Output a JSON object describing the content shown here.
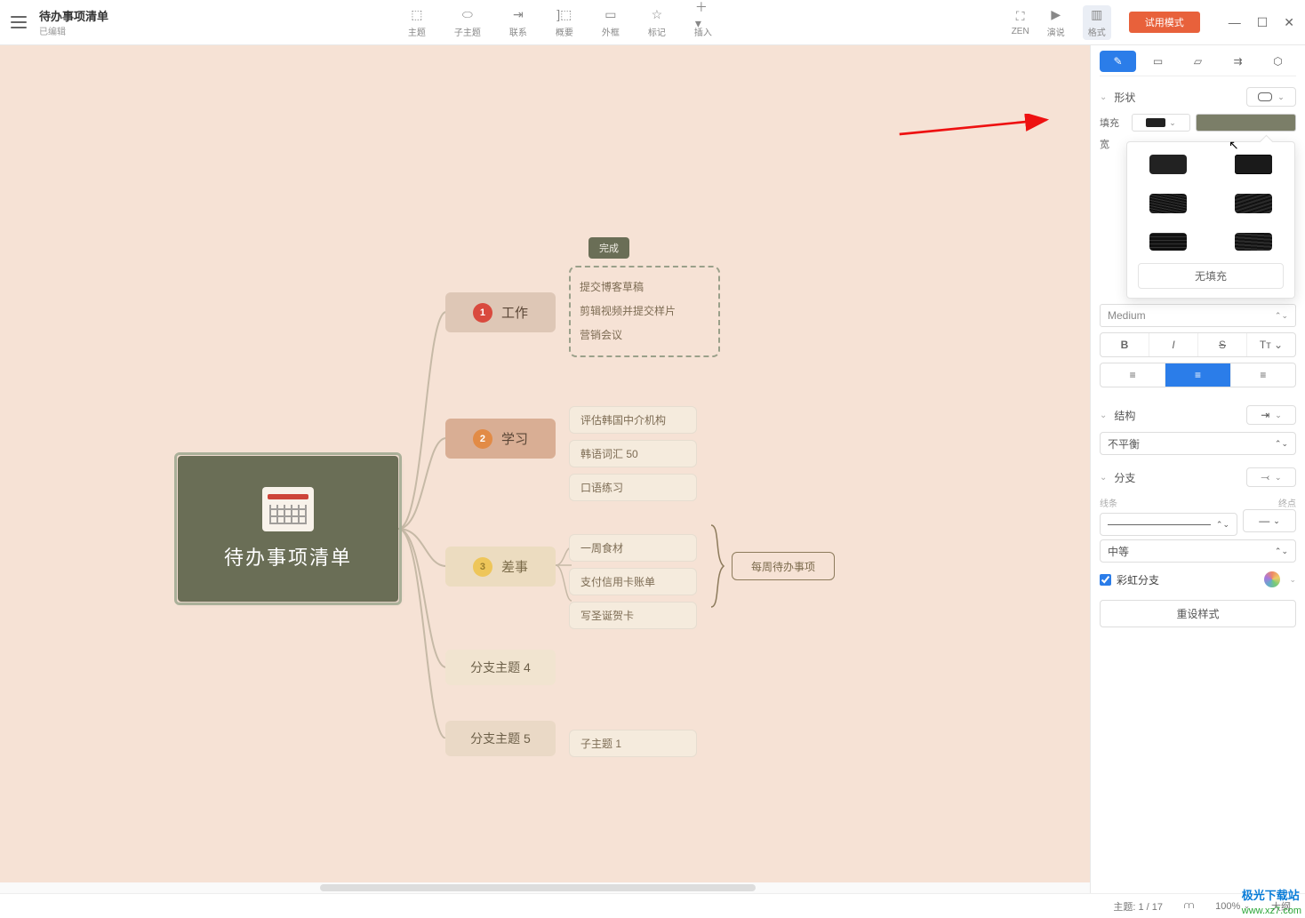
{
  "doc": {
    "title": "待办事项清单",
    "status": "已编辑"
  },
  "toolbar": {
    "center": [
      {
        "icon": "⬚",
        "label": "主题"
      },
      {
        "icon": "⬭",
        "label": "子主题"
      },
      {
        "icon": "⇥",
        "label": "联系"
      },
      {
        "icon": "]⬚",
        "label": "概要"
      },
      {
        "icon": "▭",
        "label": "外框"
      },
      {
        "icon": "☆",
        "label": "标记"
      },
      {
        "icon": "＋▾",
        "label": "插入"
      }
    ],
    "right": [
      {
        "icon": "⛶",
        "label": "ZEN"
      },
      {
        "icon": "▶",
        "label": "演说"
      },
      {
        "icon": "▥",
        "label": "格式"
      }
    ],
    "trial": "试用模式"
  },
  "root": {
    "title": "待办事项清单"
  },
  "topics": {
    "t1": {
      "label": "工作",
      "num": "1"
    },
    "t2": {
      "label": "学习",
      "num": "2"
    },
    "t3": {
      "label": "差事",
      "num": "3"
    },
    "t4": {
      "label": "分支主题 4"
    },
    "t5": {
      "label": "分支主题 5"
    }
  },
  "done_tag": "完成",
  "group1": [
    "提交博客草稿",
    "剪辑视频并提交样片",
    "营销会议"
  ],
  "group2": [
    "评估韩国中介机构",
    "韩语词汇 50",
    "口语练习"
  ],
  "group3": [
    "一周食材",
    "支付信用卡账单",
    "写圣诞贺卡"
  ],
  "group5": [
    "子主题 1"
  ],
  "callout": "每周待办事项",
  "panel": {
    "tabs": [
      "style",
      "map",
      "format",
      "theme",
      "skeleton"
    ],
    "shape": "形状",
    "fill": "填充",
    "width_label": "宽",
    "font": "Medium",
    "struct": "结构",
    "balance": "不平衡",
    "branch": "分支",
    "line_label": "线条",
    "end_label": "终点",
    "thickness": "中等",
    "rainbow": "彩虹分支",
    "reset": "重设样式",
    "no_fill": "无填充",
    "fill_color": "#7b7e68"
  },
  "status": {
    "topic_count": "主题: 1 / 17",
    "zoom": "100%",
    "outline": "大纲"
  },
  "watermark": {
    "line1": "极光下载站",
    "line2": "www.xz7.com"
  }
}
